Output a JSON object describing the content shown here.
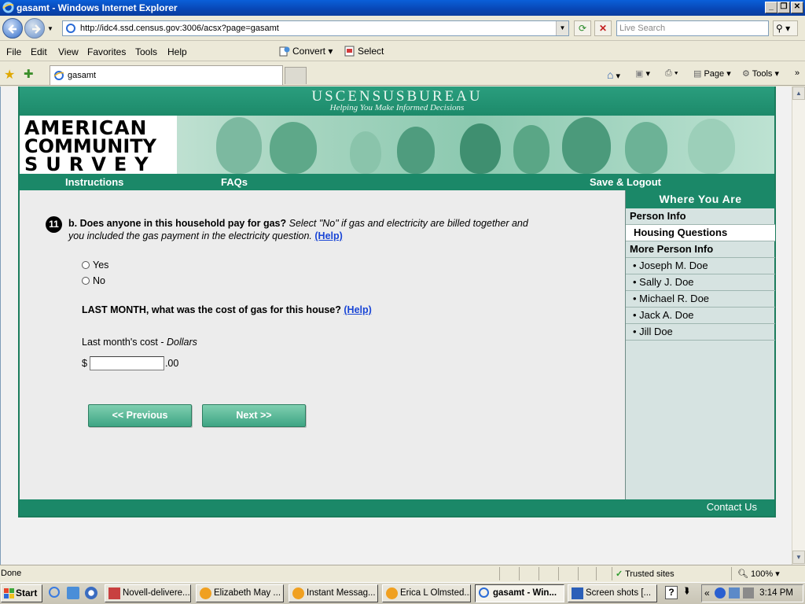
{
  "window": {
    "title": "gasamt - Windows Internet Explorer",
    "min_glyph": "_",
    "max_glyph": "❐",
    "close_glyph": "✕"
  },
  "address": {
    "url": "http://idc4.ssd.census.gov:3006/acsx?page=gasamt",
    "search_placeholder": "Live Search"
  },
  "menu": {
    "items": [
      "File",
      "Edit",
      "View",
      "Favorites",
      "Tools",
      "Help"
    ],
    "convert_label": "Convert",
    "select_label": "Select"
  },
  "tabs": {
    "active_tab": "gasamt",
    "page_label": "Page",
    "tools_label": "Tools"
  },
  "site": {
    "bureau_name": "USCENSUSBUREAU",
    "bureau_tagline": "Helping You Make Informed Decisions",
    "logo_line1": "AMERICAN",
    "logo_line2": "COMMUNITY",
    "logo_line3": "SURVEY",
    "nav": {
      "instructions": "Instructions",
      "faqs": "FAQs",
      "save_logout": "Save & Logout"
    },
    "footer_contact": "Contact Us"
  },
  "question": {
    "number": "11",
    "part": "b.",
    "prompt": "Does anyone in this household pay for gas?",
    "instruction": "Select \"No\" if gas and electricity are billed together and you included the gas payment in the electricity question.",
    "help_label": "(Help)",
    "options": [
      "Yes",
      "No"
    ],
    "cost_question": "LAST MONTH, what was the cost of gas for this house?",
    "cost_help_label": "(Help)",
    "cost_label": "Last month's cost - ",
    "cost_unit": "Dollars",
    "currency_symbol": "$",
    "cents_suffix": ".00",
    "cost_value": "",
    "previous_label": "<<   Previous",
    "next_label": "Next   >>"
  },
  "sidebar": {
    "heading": "Where You Are",
    "person_info": "Person Info",
    "housing_questions": "Housing Questions",
    "more_person_info": "More Person Info",
    "people": [
      "• Joseph M. Doe",
      "• Sally J. Doe",
      "• Michael R. Doe",
      "• Jack A. Doe",
      "• Jill Doe"
    ]
  },
  "status": {
    "text": "Done",
    "zone": "Trusted sites",
    "zoom": "100%"
  },
  "taskbar": {
    "start_label": "Start",
    "tasks": [
      "Novell-delivere...",
      "Elizabeth May ...",
      "Instant Messag...",
      "Erica L Olmsted...",
      "gasamt - Win...",
      "Screen shots [..."
    ],
    "clock": "3:14 PM"
  },
  "colors": {
    "census_green": "#1b8868",
    "button_green": "#3ea584",
    "help_link": "#1a46d6",
    "sidebar_bg": "#d6e3e1"
  }
}
